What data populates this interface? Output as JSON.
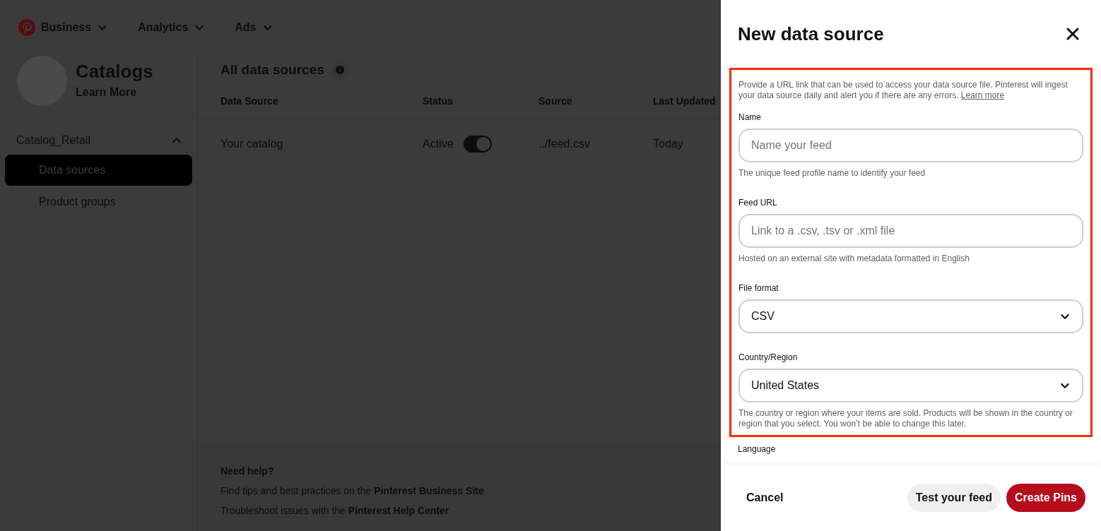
{
  "nav": [
    {
      "label": "Business"
    },
    {
      "label": "Analytics"
    },
    {
      "label": "Ads"
    }
  ],
  "sidebar": {
    "title": "Catalogs",
    "link": "Learn More",
    "group": {
      "label": "Catalog_Retail",
      "expanded": true,
      "items": [
        {
          "label": "Data sources",
          "selected": true
        },
        {
          "label": "Product groups",
          "selected": false
        }
      ]
    }
  },
  "main": {
    "title": "All data sources",
    "columns": [
      "Data Source",
      "Status",
      "Source",
      "Last Updated"
    ],
    "rows": [
      {
        "name": "Your catalog",
        "status": "Active",
        "on": true,
        "source": "../feed.csv",
        "updated": "Today"
      }
    ]
  },
  "help": {
    "title": "Need help?",
    "lines": [
      "Find tips and best practices on the **Pinterest Business Site**",
      "Troubleshoot issues with the **Pinterest Help Center**"
    ]
  },
  "drawer": {
    "title": "New data source",
    "intro": "Provide a URL link that can be used to access your data source file. Pinterest will ingest your data source daily and alert you if there are any errors.",
    "intro_link": "Learn more",
    "fields": [
      {
        "kind": "text",
        "label": "Name",
        "placeholder": "Name your feed",
        "help": "The unique feed profile name to identify your feed"
      },
      {
        "kind": "text",
        "label": "Feed URL",
        "placeholder": "Link to a .csv, .tsv or .xml file",
        "help": "Hosted on an external site with metadata formatted in English"
      },
      {
        "kind": "select",
        "label": "File format",
        "value": "CSV"
      },
      {
        "kind": "select",
        "label": "Country/Region",
        "value": "United States",
        "help": "The country or region where your items are sold. Products will be shown in the country or region that you select. You won’t be able to change this later."
      }
    ],
    "next_label": "Language",
    "buttons": {
      "cancel": "Cancel",
      "test": "Test your feed",
      "create": "Create Pins"
    }
  }
}
